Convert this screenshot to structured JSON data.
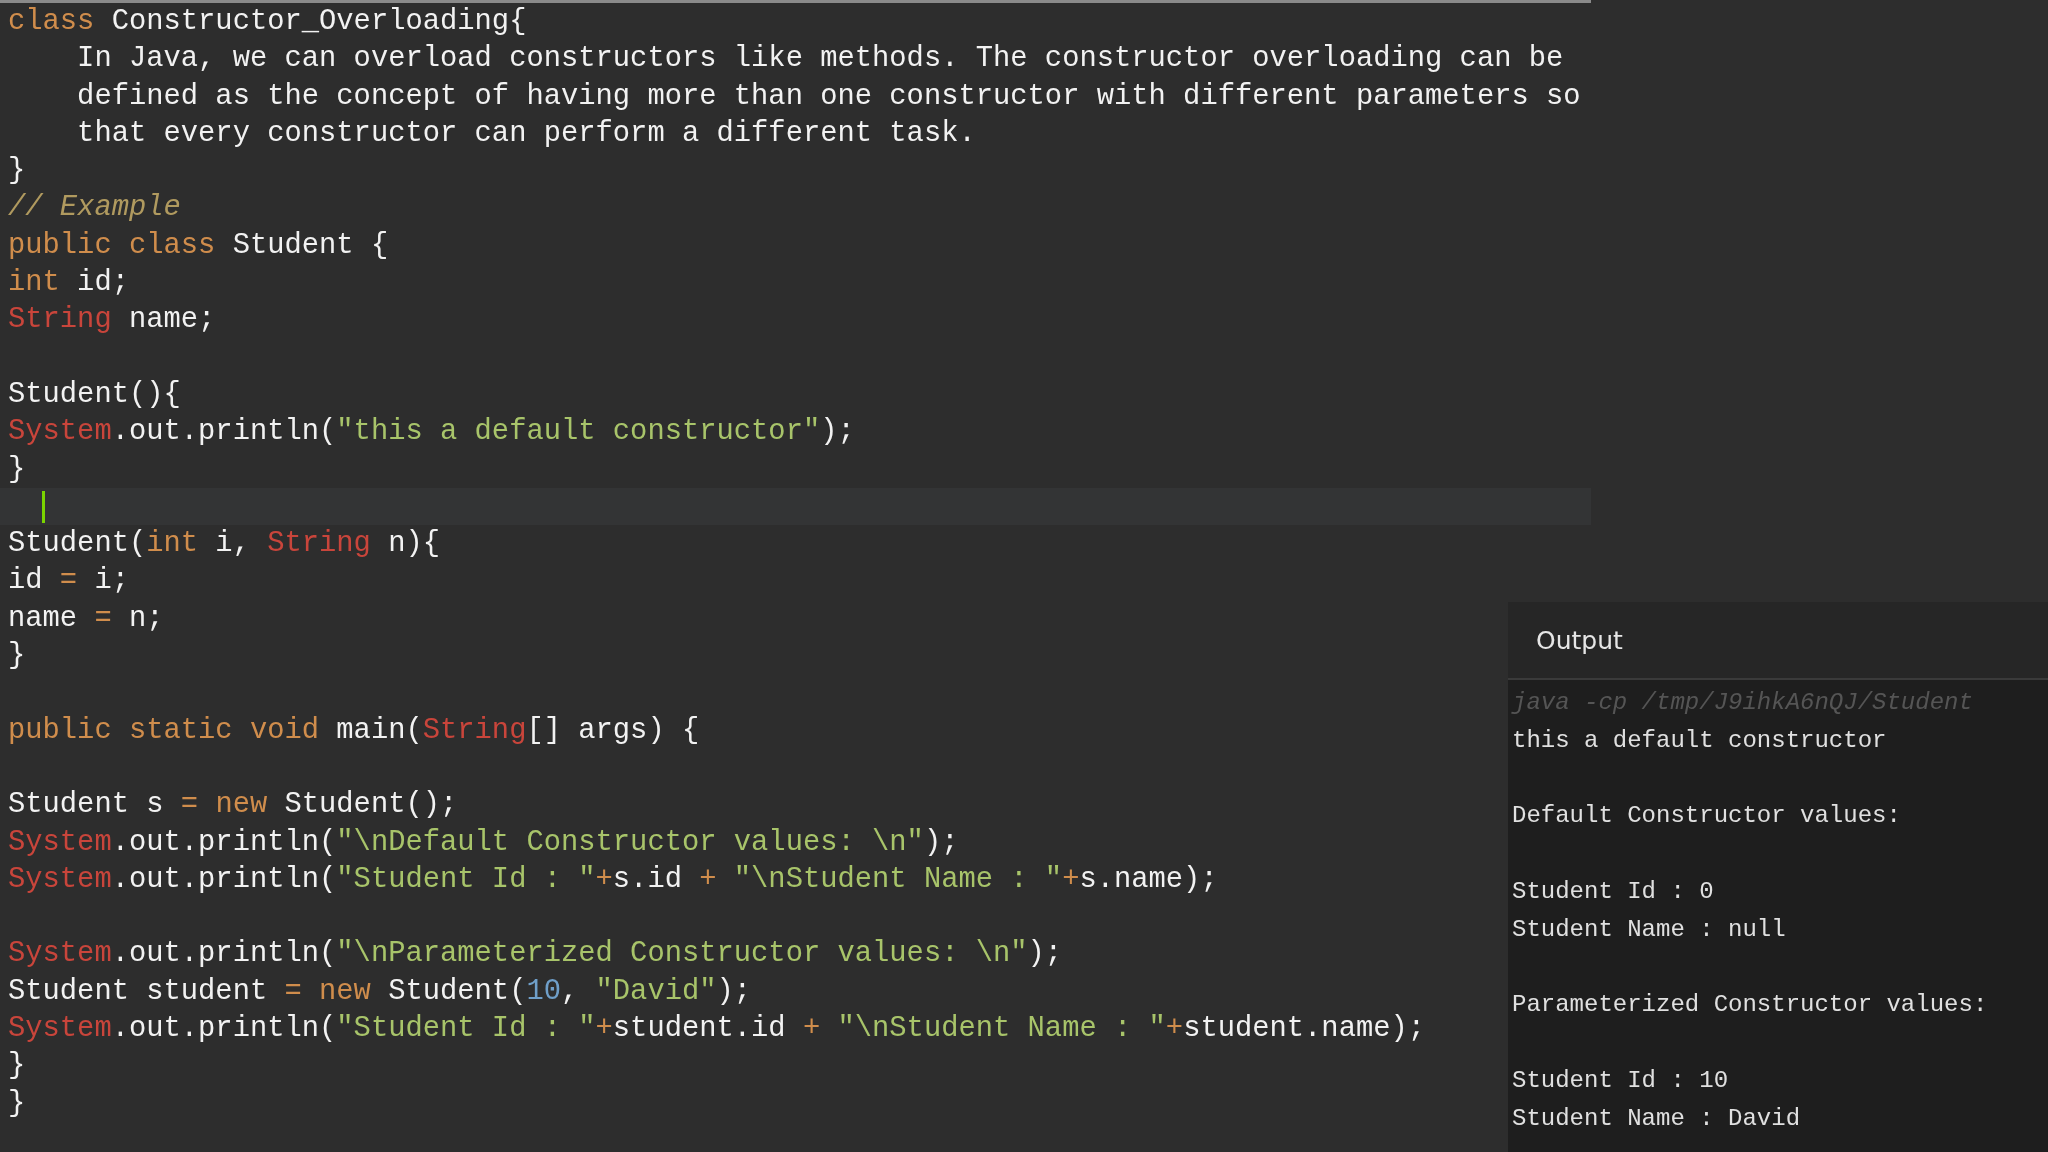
{
  "code_lines": [
    {
      "kind": "code",
      "tokens": [
        {
          "kind": "kw",
          "t": "class"
        },
        {
          "kind": "plain",
          "t": " Constructor_Overloading{"
        }
      ]
    },
    {
      "kind": "code",
      "tokens": [
        {
          "kind": "plain",
          "t": "    In Java, we can overload constructors like methods. The constructor overloading can be"
        }
      ]
    },
    {
      "kind": "code",
      "tokens": [
        {
          "kind": "plain",
          "t": "    defined as the concept of having more than one constructor with different parameters so"
        }
      ]
    },
    {
      "kind": "code",
      "tokens": [
        {
          "kind": "plain",
          "t": "    that every constructor can perform a different task."
        }
      ]
    },
    {
      "kind": "code",
      "tokens": [
        {
          "kind": "plain",
          "t": "}"
        }
      ]
    },
    {
      "kind": "code",
      "tokens": [
        {
          "kind": "comment",
          "t": "// Example"
        }
      ]
    },
    {
      "kind": "code",
      "tokens": [
        {
          "kind": "kw",
          "t": "public class"
        },
        {
          "kind": "plain",
          "t": " Student {"
        }
      ]
    },
    {
      "kind": "code",
      "tokens": [
        {
          "kind": "kw",
          "t": "int"
        },
        {
          "kind": "plain",
          "t": " id;"
        }
      ]
    },
    {
      "kind": "code",
      "tokens": [
        {
          "kind": "type",
          "t": "String"
        },
        {
          "kind": "plain",
          "t": " name;"
        }
      ]
    },
    {
      "kind": "blank",
      "current": false
    },
    {
      "kind": "code",
      "tokens": [
        {
          "kind": "plain",
          "t": "Student(){"
        }
      ]
    },
    {
      "kind": "code",
      "tokens": [
        {
          "kind": "type",
          "t": "System"
        },
        {
          "kind": "plain",
          "t": ".out.println("
        },
        {
          "kind": "str",
          "t": "\"this a default constructor\""
        },
        {
          "kind": "plain",
          "t": ");"
        }
      ]
    },
    {
      "kind": "code",
      "tokens": [
        {
          "kind": "plain",
          "t": "}"
        }
      ]
    },
    {
      "kind": "blank",
      "current": true
    },
    {
      "kind": "code",
      "tokens": [
        {
          "kind": "plain",
          "t": "Student("
        },
        {
          "kind": "kw",
          "t": "int"
        },
        {
          "kind": "plain",
          "t": " i, "
        },
        {
          "kind": "type",
          "t": "String"
        },
        {
          "kind": "plain",
          "t": " n){"
        }
      ]
    },
    {
      "kind": "code",
      "tokens": [
        {
          "kind": "plain",
          "t": "id "
        },
        {
          "kind": "op",
          "t": "="
        },
        {
          "kind": "plain",
          "t": " i;"
        }
      ]
    },
    {
      "kind": "code",
      "tokens": [
        {
          "kind": "plain",
          "t": "name "
        },
        {
          "kind": "op",
          "t": "="
        },
        {
          "kind": "plain",
          "t": " n;"
        }
      ]
    },
    {
      "kind": "code",
      "tokens": [
        {
          "kind": "plain",
          "t": "}"
        }
      ]
    },
    {
      "kind": "blank",
      "current": false
    },
    {
      "kind": "code",
      "tokens": [
        {
          "kind": "kw",
          "t": "public static void"
        },
        {
          "kind": "plain",
          "t": " main("
        },
        {
          "kind": "type",
          "t": "String"
        },
        {
          "kind": "plain",
          "t": "[] args) {"
        }
      ]
    },
    {
      "kind": "blank",
      "current": false
    },
    {
      "kind": "code",
      "tokens": [
        {
          "kind": "plain",
          "t": "Student s "
        },
        {
          "kind": "op",
          "t": "= "
        },
        {
          "kind": "kw",
          "t": "new"
        },
        {
          "kind": "plain",
          "t": " Student();"
        }
      ]
    },
    {
      "kind": "code",
      "tokens": [
        {
          "kind": "type",
          "t": "System"
        },
        {
          "kind": "plain",
          "t": ".out.println("
        },
        {
          "kind": "str",
          "t": "\"\\nDefault Constructor values: \\n\""
        },
        {
          "kind": "plain",
          "t": ");"
        }
      ]
    },
    {
      "kind": "code",
      "tokens": [
        {
          "kind": "type",
          "t": "System"
        },
        {
          "kind": "plain",
          "t": ".out.println("
        },
        {
          "kind": "str",
          "t": "\"Student Id : \""
        },
        {
          "kind": "op",
          "t": "+"
        },
        {
          "kind": "plain",
          "t": "s.id "
        },
        {
          "kind": "op",
          "t": "+ "
        },
        {
          "kind": "str",
          "t": "\"\\nStudent Name : \""
        },
        {
          "kind": "op",
          "t": "+"
        },
        {
          "kind": "plain",
          "t": "s.name);"
        }
      ]
    },
    {
      "kind": "blank",
      "current": false
    },
    {
      "kind": "code",
      "tokens": [
        {
          "kind": "type",
          "t": "System"
        },
        {
          "kind": "plain",
          "t": ".out.println("
        },
        {
          "kind": "str",
          "t": "\"\\nParameterized Constructor values: \\n\""
        },
        {
          "kind": "plain",
          "t": ");"
        }
      ]
    },
    {
      "kind": "code",
      "tokens": [
        {
          "kind": "plain",
          "t": "Student student "
        },
        {
          "kind": "op",
          "t": "= "
        },
        {
          "kind": "kw",
          "t": "new"
        },
        {
          "kind": "plain",
          "t": " Student("
        },
        {
          "kind": "num",
          "t": "10"
        },
        {
          "kind": "plain",
          "t": ", "
        },
        {
          "kind": "str",
          "t": "\"David\""
        },
        {
          "kind": "plain",
          "t": ");"
        }
      ]
    },
    {
      "kind": "code",
      "tokens": [
        {
          "kind": "type",
          "t": "System"
        },
        {
          "kind": "plain",
          "t": ".out.println("
        },
        {
          "kind": "str",
          "t": "\"Student Id : \""
        },
        {
          "kind": "op",
          "t": "+"
        },
        {
          "kind": "plain",
          "t": "student.id "
        },
        {
          "kind": "op",
          "t": "+ "
        },
        {
          "kind": "str",
          "t": "\"\\nStudent Name : \""
        },
        {
          "kind": "op",
          "t": "+"
        },
        {
          "kind": "plain",
          "t": "student.name);"
        }
      ]
    },
    {
      "kind": "code",
      "tokens": [
        {
          "kind": "plain",
          "t": "}"
        }
      ]
    },
    {
      "kind": "code",
      "tokens": [
        {
          "kind": "plain",
          "t": "}"
        }
      ]
    }
  ],
  "output": {
    "title": "Output",
    "lines": [
      {
        "kind": "command",
        "text": "java -cp /tmp/J9ihkA6nQJ/Student"
      },
      {
        "kind": "text",
        "text": "this a default constructor"
      },
      {
        "kind": "blank"
      },
      {
        "kind": "text",
        "text": "Default Constructor values:"
      },
      {
        "kind": "blank"
      },
      {
        "kind": "text",
        "text": "Student Id : 0"
      },
      {
        "kind": "text",
        "text": "Student Name : null"
      },
      {
        "kind": "blank"
      },
      {
        "kind": "text",
        "text": "Parameterized Constructor values:"
      },
      {
        "kind": "blank"
      },
      {
        "kind": "text",
        "text": "Student Id : 10"
      },
      {
        "kind": "text",
        "text": "Student Name : David"
      }
    ]
  }
}
